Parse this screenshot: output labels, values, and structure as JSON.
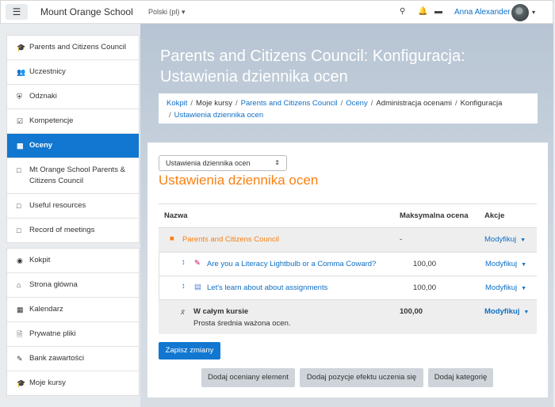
{
  "navbar": {
    "menu_icon": "hamburger-icon",
    "site_name": "Mount Orange School",
    "language": "Polski (pl)",
    "search_icon": "search-icon",
    "notifications_icon": "bell-icon",
    "messages_icon": "chat-icon",
    "user_name": "Anna Alexander"
  },
  "sidebar": {
    "group1": [
      {
        "label": "Parents and Citizens Council",
        "icon": "graduation-cap-icon"
      },
      {
        "label": "Uczestnicy",
        "icon": "users-icon"
      },
      {
        "label": "Odznaki",
        "icon": "shield-icon"
      },
      {
        "label": "Kompetencje",
        "icon": "checkbox-icon"
      },
      {
        "label": "Oceny",
        "icon": "table-icon",
        "active": true
      },
      {
        "label": "Mt Orange School Parents & Citizens Council",
        "icon": "folder-icon"
      },
      {
        "label": "Useful resources",
        "icon": "folder-icon"
      },
      {
        "label": "Record of meetings",
        "icon": "folder-icon"
      }
    ],
    "group2": [
      {
        "label": "Kokpit",
        "icon": "dashboard-icon"
      },
      {
        "label": "Strona główna",
        "icon": "home-icon"
      },
      {
        "label": "Kalendarz",
        "icon": "calendar-icon"
      },
      {
        "label": "Prywatne pliki",
        "icon": "file-icon"
      },
      {
        "label": "Bank zawartości",
        "icon": "paintbrush-icon"
      },
      {
        "label": "Moje kursy",
        "icon": "graduation-cap-icon"
      }
    ]
  },
  "header": {
    "title": "Parents and Citizens Council: Konfiguracja: Ustawienia dziennika ocen",
    "breadcrumb": [
      {
        "label": "Kokpit",
        "link": true
      },
      {
        "label": "Moje kursy",
        "link": false
      },
      {
        "label": "Parents and Citizens Council",
        "link": true
      },
      {
        "label": "Oceny",
        "link": true
      },
      {
        "label": "Administracja ocenami",
        "link": false
      },
      {
        "label": "Konfiguracja",
        "link": false
      },
      {
        "label": "Ustawienia dziennika ocen",
        "link": true
      }
    ]
  },
  "main": {
    "select_value": "Ustawienia dziennika ocen",
    "section_title": "Ustawienia dziennika ocen",
    "table": {
      "headers": {
        "name": "Nazwa",
        "max": "Maksymalna ocena",
        "actions": "Akcje"
      },
      "category": {
        "name": "Parents and Citizens Council",
        "max": "-",
        "action": "Modyfikuj"
      },
      "items": [
        {
          "name": "Are you a Literacy Lightbulb or a Comma Coward?",
          "max": "100,00",
          "action": "Modyfikuj",
          "icon": "assignment-icon"
        },
        {
          "name": "Let's learn about about assignments",
          "max": "100,00",
          "action": "Modyfikuj",
          "icon": "page-icon"
        }
      ],
      "total": {
        "name": "W całym kursie",
        "note": "Prosta średnia ważona ocen.",
        "max": "100,00",
        "action": "Modyfikuj"
      }
    },
    "save_button": "Zapisz zmiany",
    "buttons": [
      "Dodaj oceniany element",
      "Dodaj pozycje efektu uczenia się",
      "Dodaj kategorię"
    ]
  },
  "colors": {
    "accent": "#1177d1",
    "brand_orange": "#f98012",
    "link": "#0f6fc5"
  }
}
